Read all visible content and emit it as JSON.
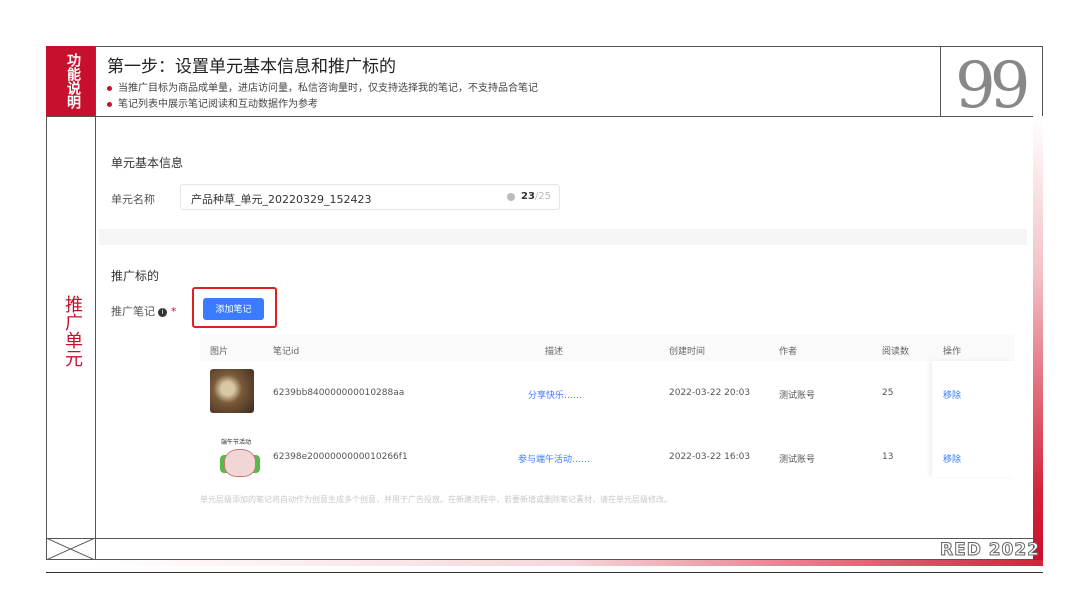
{
  "header": {
    "side_label": "功能说明",
    "title": "第一步：设置单元基本信息和推广标的",
    "bullets": [
      "当推广目标为商品成单量，进店访问量，私信咨询量时，仅支持选择我的笔记，不支持品合笔记",
      "笔记列表中展示笔记阅读和互动数据作为参考"
    ],
    "quote_glyph": "99"
  },
  "side_section_label": "推广单元",
  "form": {
    "basic_section_title": "单元基本信息",
    "unit_name_label": "单元名称",
    "unit_name_value": "产品种草_单元_20220329_152423",
    "char_count": "23",
    "char_max": "/25",
    "target_section_title": "推广标的",
    "note_label": "推广笔记",
    "add_note_button": "添加笔记"
  },
  "table": {
    "columns": [
      "图片",
      "笔记id",
      "描述",
      "创建时间",
      "作者",
      "阅读数",
      "操作"
    ],
    "rows": [
      {
        "id": "6239bb840000000010288aa",
        "desc": "分享快乐……",
        "created": "2022-03-22 20:03",
        "author": "测试账号",
        "reads": "25",
        "action": "移除"
      },
      {
        "id": "62398e2000000000010266f1",
        "desc": "参与端午活动……",
        "created": "2022-03-22 16:03",
        "author": "测试账号",
        "reads": "13",
        "action": "移除"
      }
    ],
    "thumb2_caption": "端午节活动"
  },
  "footnote": "单元层级添加的笔记将自动作为创意生成多个创意，并用于广告投放。在新建流程中，若要新增或删除笔记素材，请在单元层级修改。",
  "brand": "RED 2022"
}
